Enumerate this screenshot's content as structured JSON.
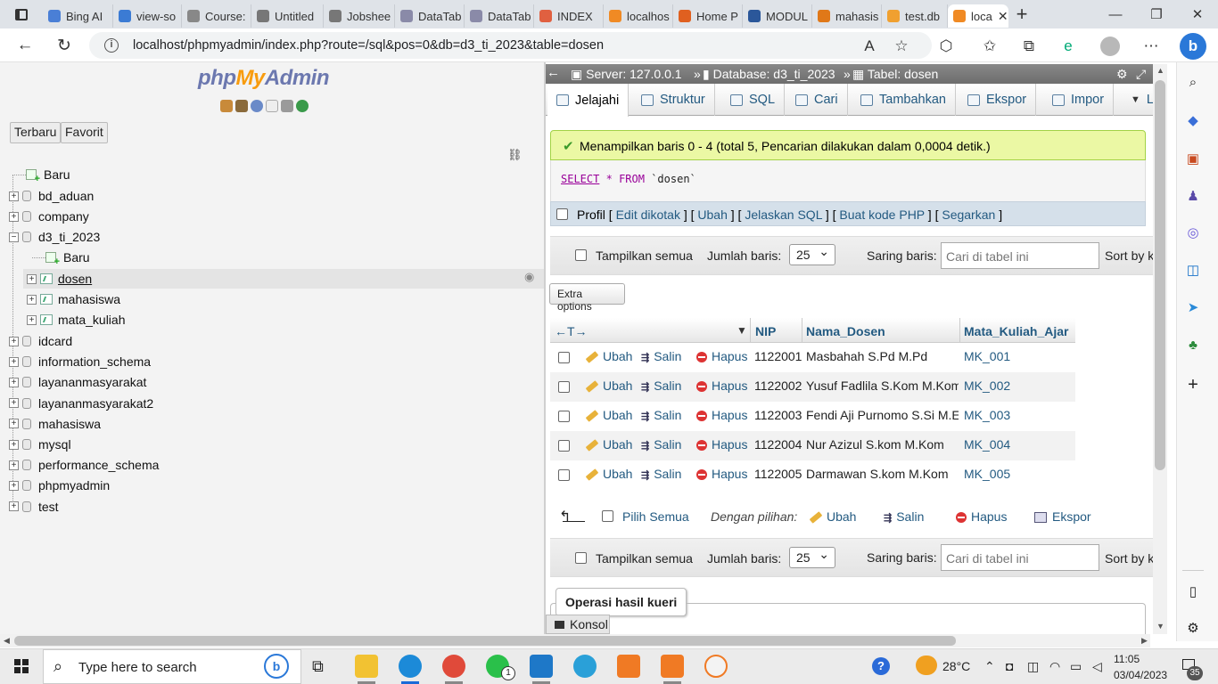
{
  "browser": {
    "tabs": [
      {
        "label": "Bing AI",
        "color": "#4a7fd6"
      },
      {
        "label": "view-so",
        "color": "#3b7bd4"
      },
      {
        "label": "Course:",
        "color": "#888888"
      },
      {
        "label": "Untitled",
        "color": "#777777"
      },
      {
        "label": "Jobshee",
        "color": "#777777"
      },
      {
        "label": "DataTab",
        "color": "#8a8aa8"
      },
      {
        "label": "DataTab",
        "color": "#8a8aa8"
      },
      {
        "label": "INDEX",
        "color": "#e06040"
      },
      {
        "label": "localhos",
        "color": "#f08a24"
      },
      {
        "label": "Home P",
        "color": "#e06020"
      },
      {
        "label": "MODUL",
        "color": "#2b579a"
      },
      {
        "label": "mahasis",
        "color": "#e07818"
      },
      {
        "label": "test.db",
        "color": "#f0a030"
      },
      {
        "label": "loca",
        "color": "#f08a24"
      }
    ],
    "url": "localhost/phpmyadmin/index.php?route=/sql&pos=0&db=d3_ti_2023&table=dosen"
  },
  "pma": {
    "logo_php": "php",
    "logo_my": "My",
    "logo_admin": "Admin",
    "btn_recent": "Terbaru",
    "btn_favorite": "Favorit",
    "tree": {
      "new": "Baru",
      "databases": [
        "bd_aduan",
        "company",
        "d3_ti_2023"
      ],
      "sub_new": "Baru",
      "tables": [
        "dosen",
        "mahasiswa",
        "mata_kuliah"
      ],
      "more_databases": [
        "idcard",
        "information_schema",
        "layananmasyarakat",
        "layananmasyarakat2",
        "mahasiswa",
        "mysql",
        "performance_schema",
        "phpmyadmin",
        "test"
      ]
    },
    "breadcrumb": {
      "server": "Server: 127.0.0.1",
      "database": "Database: d3_ti_2023",
      "table": "Tabel: dosen"
    },
    "tabs": [
      "Jelajahi",
      "Struktur",
      "SQL",
      "Cari",
      "Tambahkan",
      "Ekspor",
      "Impor",
      "L"
    ],
    "success_message": "Menampilkan baris 0 - 4 (total 5, Pencarian dilakukan dalam 0,0004 detik.)",
    "sql": {
      "kw1": "SELECT",
      "star": "*",
      "kw2": "FROM",
      "table": "`dosen`"
    },
    "profile": {
      "label": "Profil",
      "open": "[",
      "sep": "] [",
      "close": "]",
      "links": [
        "Edit dikotak",
        "Ubah",
        "Jelaskan SQL",
        "Buat kode PHP",
        "Segarkan"
      ]
    },
    "nav": {
      "show_all": "Tampilkan semua",
      "rows_label": "Jumlah baris:",
      "rows_value": "25",
      "filter_label": "Saring baris:",
      "filter_placeholder": "Cari di tabel ini",
      "sort_label": "Sort by k"
    },
    "extra_options": "Extra options",
    "columns": [
      "NIP",
      "Nama_Dosen",
      "Mata_Kuliah_Ajar"
    ],
    "row_actions": {
      "edit": "Ubah",
      "copy": "Salin",
      "delete": "Hapus"
    },
    "rows": [
      {
        "nip": "1122001",
        "nama": "Masbahah S.Pd M.Pd",
        "mk": "MK_001"
      },
      {
        "nip": "1122002",
        "nama": "Yusuf Fadlila S.Kom M.Kom",
        "mk": "MK_002"
      },
      {
        "nip": "1122003",
        "nama": "Fendi Aji Purnomo S.Si M.Eg",
        "mk": "MK_003"
      },
      {
        "nip": "1122004",
        "nama": "Nur Azizul S.kom M.Kom",
        "mk": "MK_004"
      },
      {
        "nip": "1122005",
        "nama": "Darmawan S.kom M.Kom",
        "mk": "MK_005"
      }
    ],
    "bottom": {
      "select_all": "Pilih Semua",
      "with_selected": "Dengan pilihan:",
      "edit": "Ubah",
      "copy": "Salin",
      "delete": "Hapus",
      "export": "Ekspor"
    },
    "query_ops": "Operasi hasil kueri",
    "console": "Konsol"
  },
  "taskbar": {
    "search_placeholder": "Type here to search",
    "weather": "28°C",
    "time": "11:05",
    "date": "03/04/2023",
    "notif_count": "35",
    "whatsapp_badge": "1"
  }
}
